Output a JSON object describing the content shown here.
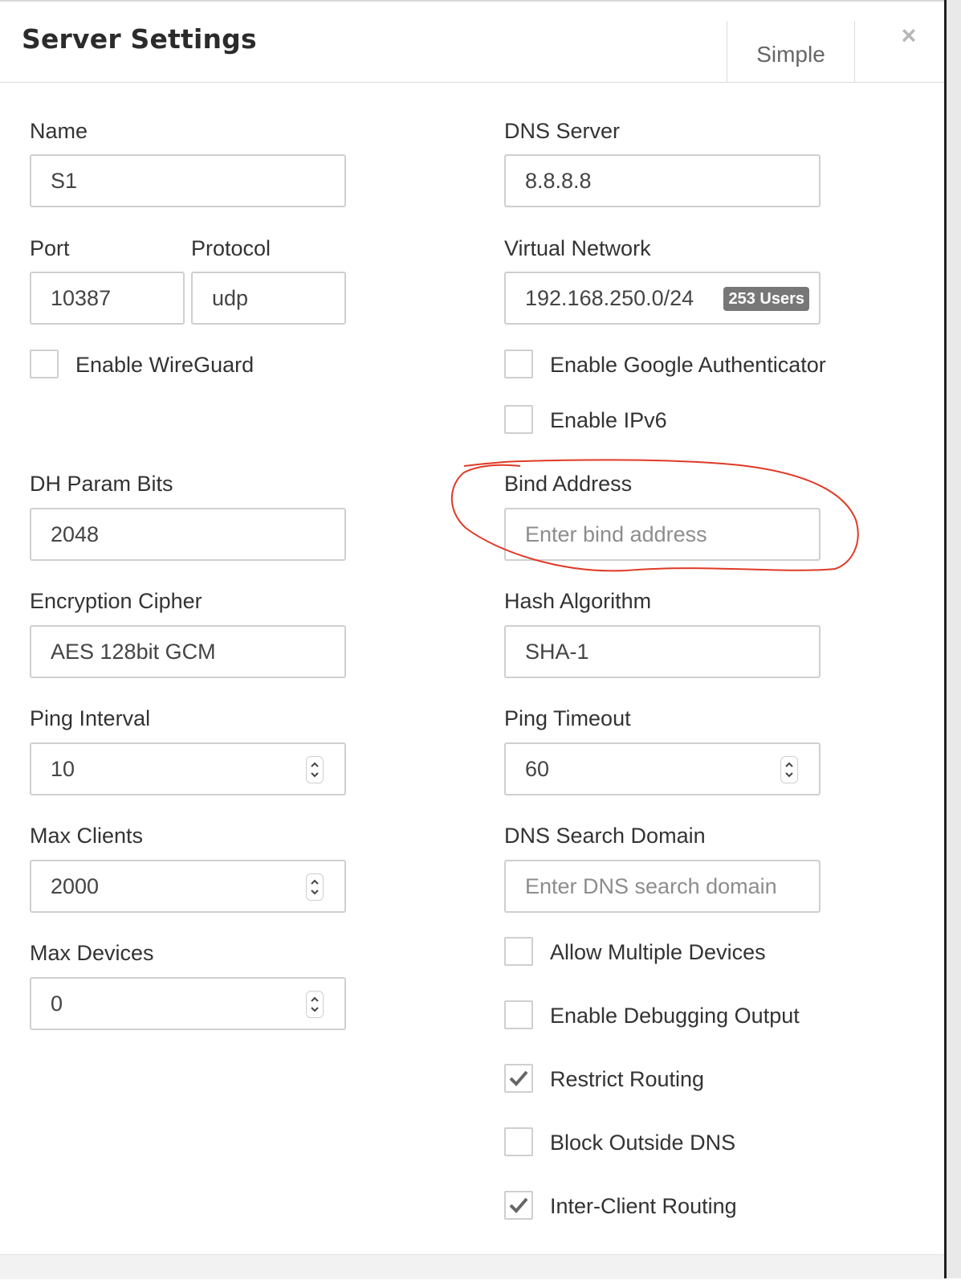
{
  "header": {
    "title": "Server Settings",
    "mode_button": "Simple",
    "close_symbol": "×"
  },
  "left": {
    "name": {
      "label": "Name",
      "value": "S1"
    },
    "port": {
      "label": "Port",
      "value": "10387"
    },
    "protocol": {
      "label": "Protocol",
      "value": "udp"
    },
    "wireguard": {
      "label": "Enable WireGuard",
      "checked": false
    },
    "dh_param_bits": {
      "label": "DH Param Bits",
      "value": "2048"
    },
    "encryption_cipher": {
      "label": "Encryption Cipher",
      "value": "AES 128bit GCM"
    },
    "ping_interval": {
      "label": "Ping Interval",
      "value": "10"
    },
    "max_clients": {
      "label": "Max Clients",
      "value": "2000"
    },
    "max_devices": {
      "label": "Max Devices",
      "value": "0"
    }
  },
  "right": {
    "dns_server": {
      "label": "DNS Server",
      "value": "8.8.8.8"
    },
    "virtual_network": {
      "label": "Virtual Network",
      "value": "192.168.250.0/24",
      "badge": "253 Users"
    },
    "google_auth": {
      "label": "Enable Google Authenticator",
      "checked": false
    },
    "ipv6": {
      "label": "Enable IPv6",
      "checked": false
    },
    "bind_address": {
      "label": "Bind Address",
      "placeholder": "Enter bind address"
    },
    "hash_algorithm": {
      "label": "Hash Algorithm",
      "value": "SHA-1"
    },
    "ping_timeout": {
      "label": "Ping Timeout",
      "value": "60"
    },
    "dns_search_domain": {
      "label": "DNS Search Domain",
      "placeholder": "Enter DNS search domain"
    },
    "multiple_devices": {
      "label": "Allow Multiple Devices",
      "checked": false
    },
    "debugging_output": {
      "label": "Enable Debugging Output",
      "checked": false
    },
    "restrict_routing": {
      "label": "Restrict Routing",
      "checked": true
    },
    "block_outside_dns": {
      "label": "Block Outside DNS",
      "checked": false
    },
    "inter_client_routing": {
      "label": "Inter-Client Routing",
      "checked": true
    }
  },
  "colors": {
    "annotation": "#e03a26",
    "badge_bg": "#777777",
    "border": "#cfcfcf"
  }
}
